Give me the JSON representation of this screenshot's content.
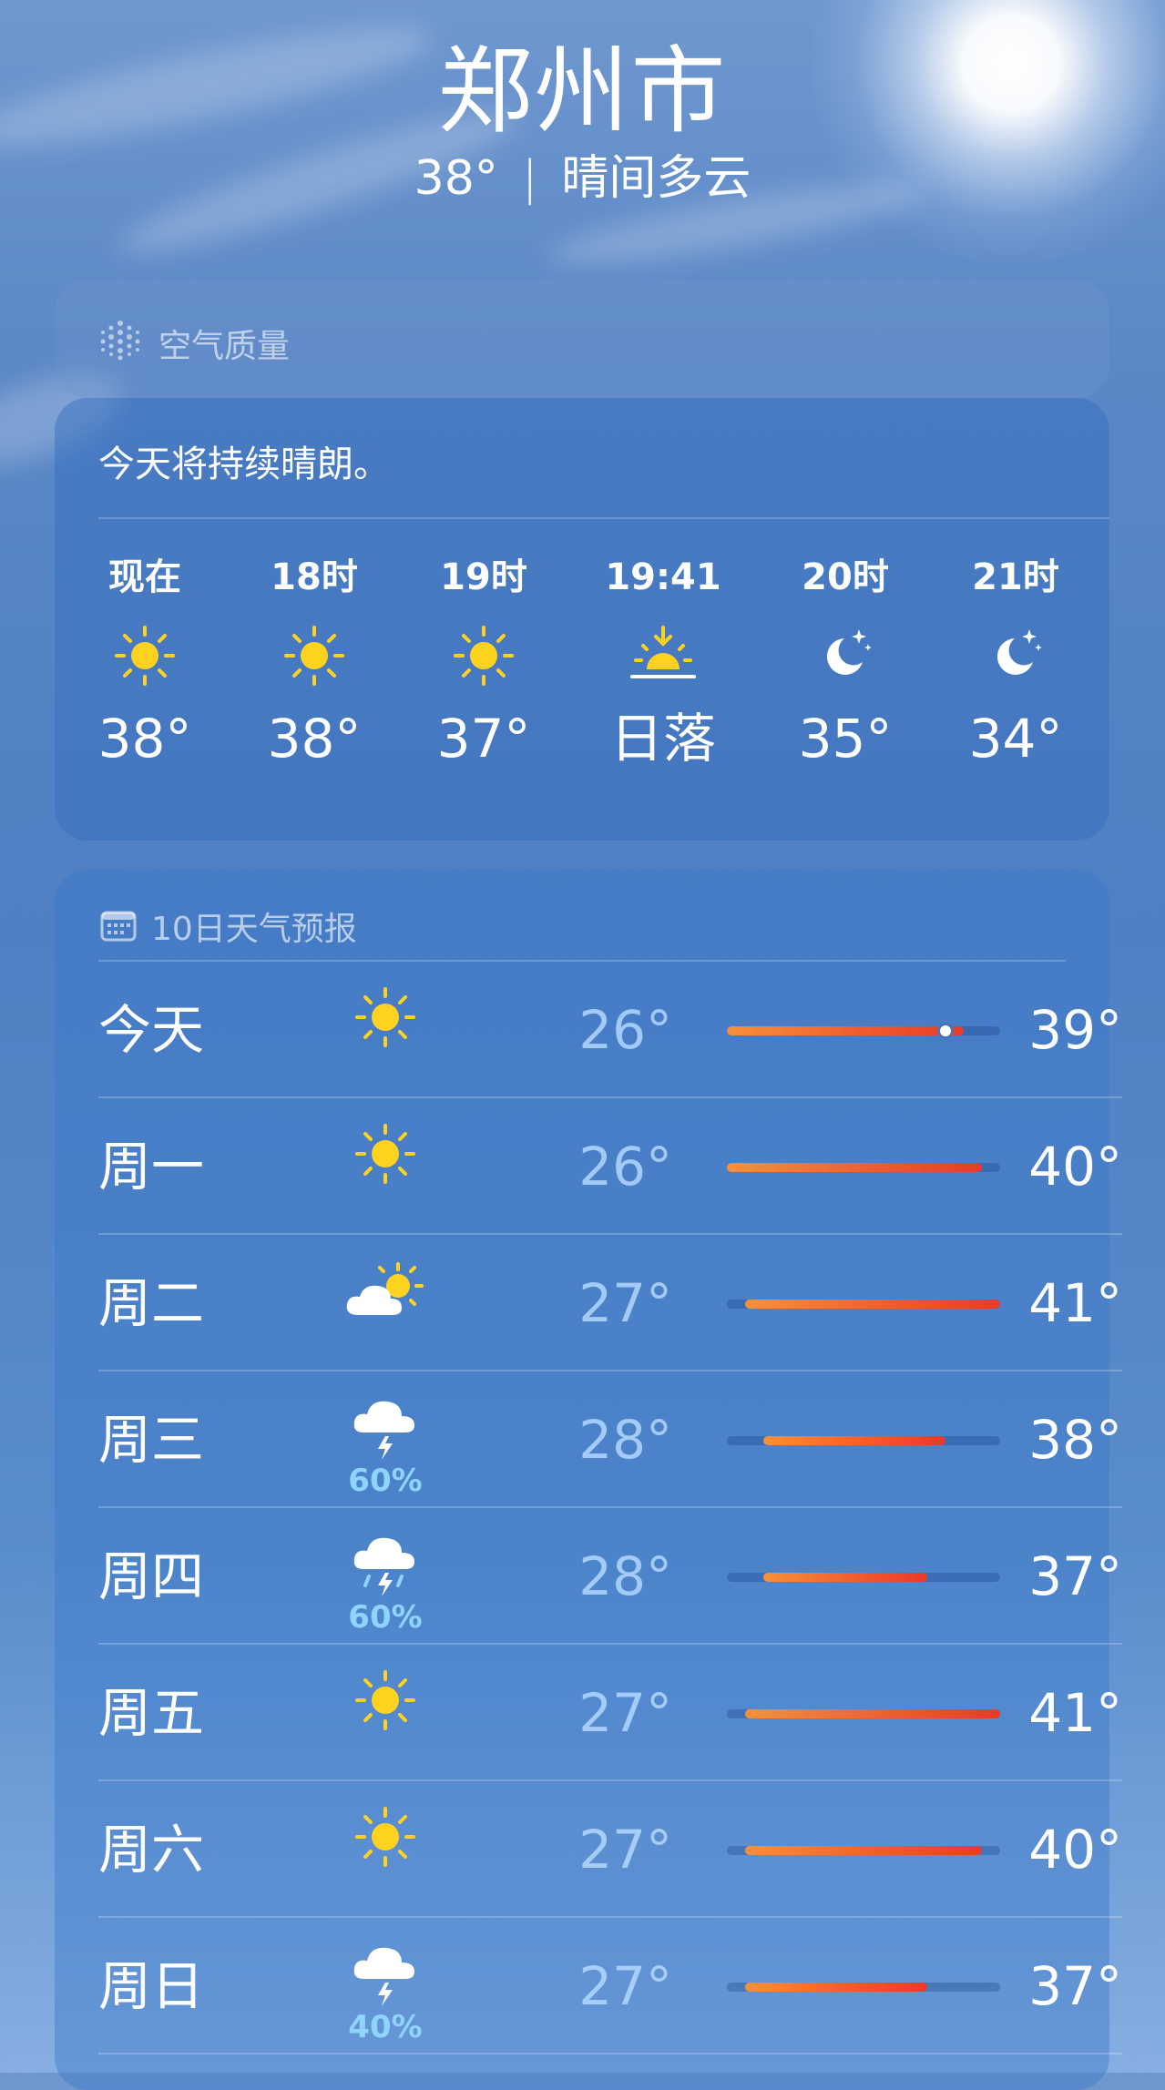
{
  "header": {
    "city": "郑州市",
    "temperature": "38°",
    "separator": "|",
    "condition": "晴间多云"
  },
  "air_quality": {
    "title": "空气质量",
    "icon": "air-quality-icon"
  },
  "hourly": {
    "summary": "今天将持续晴朗。",
    "items": [
      {
        "label": "现在",
        "icon": "sun-icon",
        "value": "38°"
      },
      {
        "label": "18时",
        "icon": "sun-icon",
        "value": "38°"
      },
      {
        "label": "19时",
        "icon": "sun-icon",
        "value": "37°"
      },
      {
        "label": "19:41",
        "icon": "sunset-icon",
        "value": "日落"
      },
      {
        "label": "20时",
        "icon": "moon-stars-icon",
        "value": "35°"
      },
      {
        "label": "21时",
        "icon": "moon-stars-icon",
        "value": "34°"
      }
    ]
  },
  "daily": {
    "title": "10日天气预报",
    "icon": "calendar-icon",
    "range_min": 26,
    "range_max": 41,
    "current_temp": 38,
    "days": [
      {
        "name": "今天",
        "icon": "sun-icon",
        "precip": "",
        "low": "26°",
        "high": "39°",
        "low_value": 26,
        "high_value": 39
      },
      {
        "name": "周一",
        "icon": "sun-icon",
        "precip": "",
        "low": "26°",
        "high": "40°",
        "low_value": 26,
        "high_value": 40
      },
      {
        "name": "周二",
        "icon": "partly-cloudy-icon",
        "precip": "",
        "low": "27°",
        "high": "41°",
        "low_value": 27,
        "high_value": 41
      },
      {
        "name": "周三",
        "icon": "thunderstorm-icon",
        "precip": "60%",
        "low": "28°",
        "high": "38°",
        "low_value": 28,
        "high_value": 38
      },
      {
        "name": "周四",
        "icon": "thunder-rain-icon",
        "precip": "60%",
        "low": "28°",
        "high": "37°",
        "low_value": 28,
        "high_value": 37
      },
      {
        "name": "周五",
        "icon": "sun-icon",
        "precip": "",
        "low": "27°",
        "high": "41°",
        "low_value": 27,
        "high_value": 41
      },
      {
        "name": "周六",
        "icon": "sun-icon",
        "precip": "",
        "low": "27°",
        "high": "40°",
        "low_value": 27,
        "high_value": 40
      },
      {
        "name": "周日",
        "icon": "thunderstorm-icon",
        "precip": "40%",
        "low": "27°",
        "high": "37°",
        "low_value": 27,
        "high_value": 37
      }
    ]
  },
  "colors": {
    "sun": "#ffd21f",
    "precip": "#8fd3ff",
    "bar_start": "#f7913a",
    "bar_end": "#e93a2a"
  }
}
